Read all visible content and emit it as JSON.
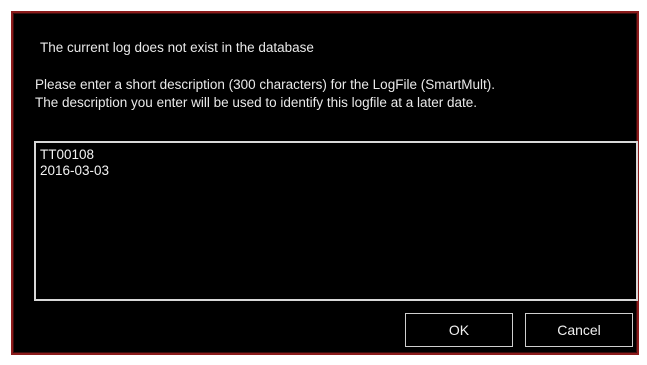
{
  "dialog": {
    "message_title": "The current log does not exist in the database",
    "message_line1": "Please enter a short description (300 characters) for the LogFile (SmartMult).",
    "message_line2": "The description you enter will be used to identify this logfile at a later date.",
    "description_lines": [
      "TT00108",
      "2016-03-03"
    ],
    "ok_label": "OK",
    "cancel_label": "Cancel"
  },
  "colors": {
    "background": "#000000",
    "border": "#8b1b1b",
    "text": "#e9e9e9"
  }
}
